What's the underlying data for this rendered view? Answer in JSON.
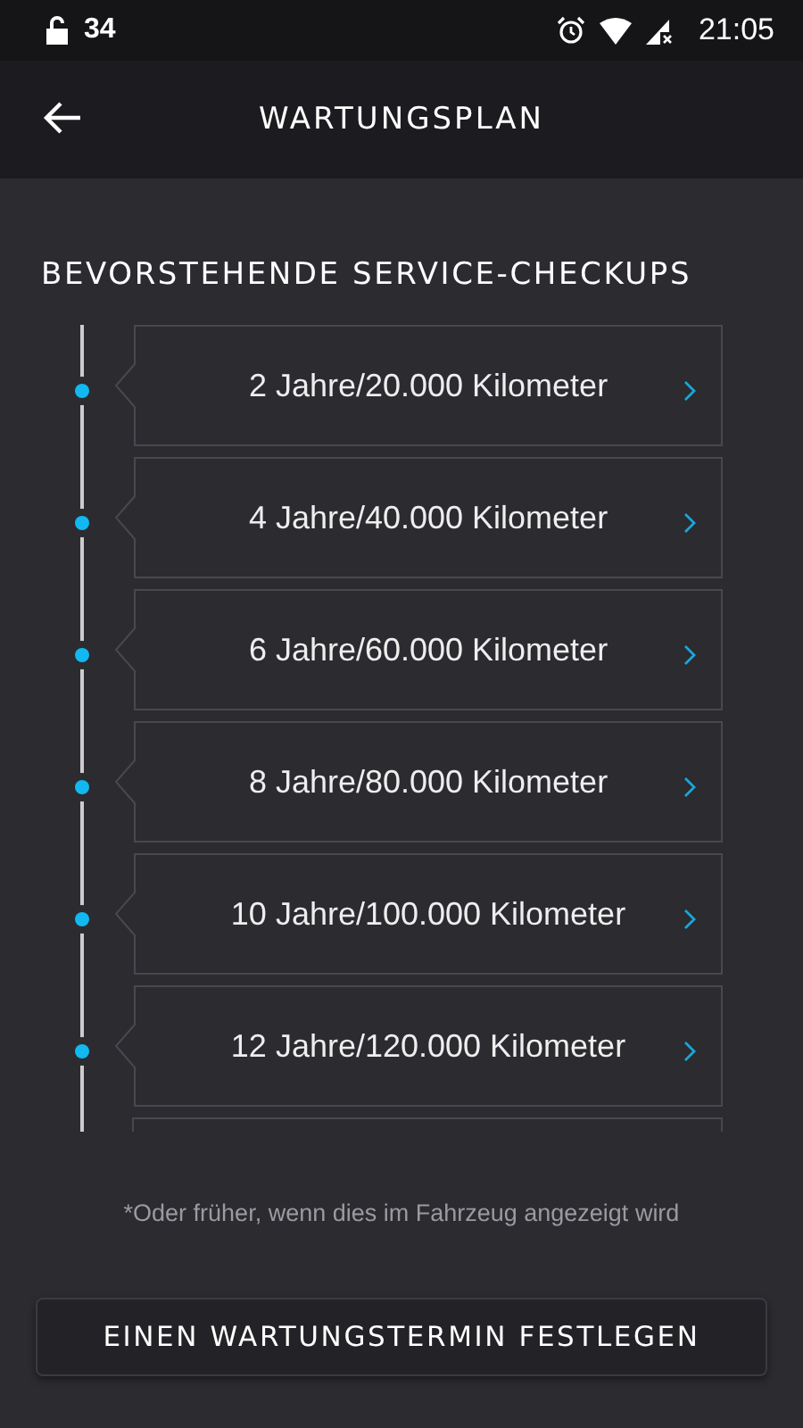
{
  "status_bar": {
    "notification": "34",
    "time": "21:05"
  },
  "header": {
    "title": "WARTUNGSPLAN"
  },
  "section_title": "BEVORSTEHENDE SERVICE-CHECKUPS",
  "checkups": [
    {
      "label": "2 Jahre/20.000 Kilometer"
    },
    {
      "label": "4 Jahre/40.000 Kilometer"
    },
    {
      "label": "6 Jahre/60.000 Kilometer"
    },
    {
      "label": "8 Jahre/80.000 Kilometer"
    },
    {
      "label": "10 Jahre/100.000 Kilometer"
    },
    {
      "label": "12 Jahre/120.000 Kilometer"
    }
  ],
  "footnote": "*Oder früher, wenn dies im Fahrzeug angezeigt wird",
  "button": "EINEN WARTUNGSTERMIN FESTLEGEN"
}
